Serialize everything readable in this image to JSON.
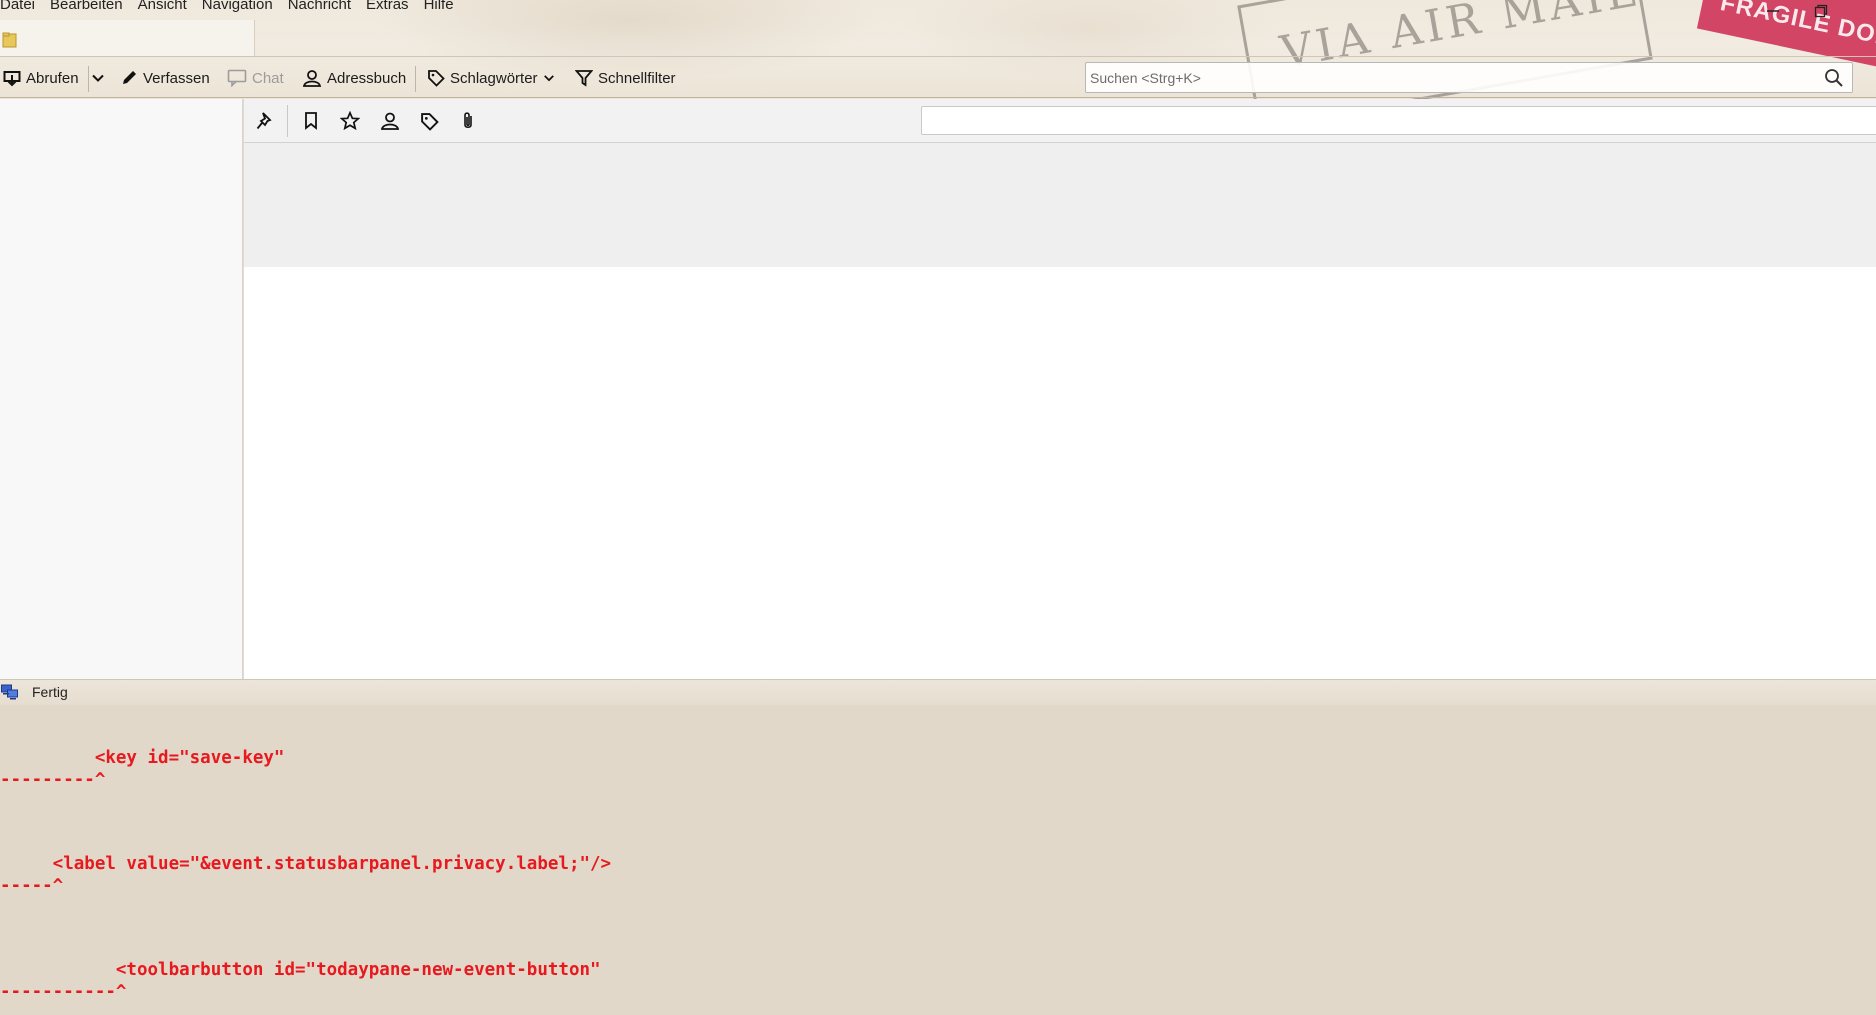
{
  "menubar": {
    "items": [
      "Datei",
      "Bearbeiten",
      "Ansicht",
      "Navigation",
      "Nachricht",
      "Extras",
      "Hilfe"
    ]
  },
  "toolbar": {
    "get_messages": "Abrufen",
    "compose": "Verfassen",
    "chat": "Chat",
    "address_book": "Adressbuch",
    "tags": "Schlagwörter",
    "quick_filter": "Schnellfilter"
  },
  "search": {
    "placeholder": "Suchen <Strg+K>"
  },
  "stamps": {
    "air_mail": "VIA AIR MAIL",
    "fragile": "FRAGILE DON'T CRUSH"
  },
  "quickfilter": {
    "buttons": [
      "sticky-pin-icon",
      "unread-bookmark-icon",
      "star-icon",
      "contact-icon",
      "tag-icon",
      "attachment-icon"
    ]
  },
  "statusbar": {
    "text": "Fertig"
  },
  "errors": [
    {
      "code": "         <key id=\"save-key\"",
      "marker": "---------^"
    },
    {
      "code": "     <label value=\"&event.statusbarpanel.privacy.label;\"/>",
      "marker": "-----^"
    },
    {
      "code": "           <toolbarbutton id=\"todaypane-new-event-button\"",
      "marker": "-----------^"
    }
  ],
  "colors": {
    "error_text": "#e8191e",
    "parchment": "#e2d9cb",
    "fragile_stamp": "#cf3458"
  }
}
